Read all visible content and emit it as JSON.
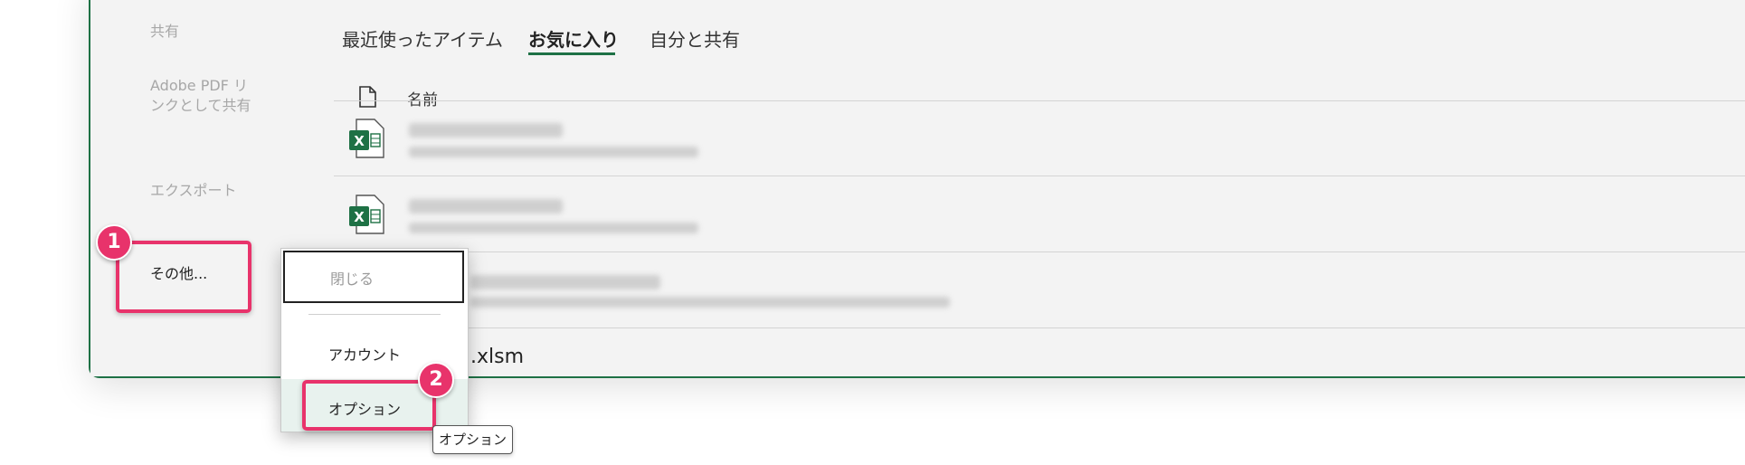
{
  "sidebar": {
    "share": "共有",
    "adobe_pdf": "Adobe PDF リンクとして共有",
    "export": "エクスポート",
    "more": "その他..."
  },
  "tabs": {
    "recent": "最近使ったアイテム",
    "favorites": "お気に入り",
    "shared": "自分と共有"
  },
  "file_list": {
    "column_name": "名前",
    "visible_file_suffix": ".xlsm"
  },
  "menu": {
    "close": "閉じる",
    "account": "アカウント",
    "options": "オプション"
  },
  "tooltip": "オプション",
  "badges": [
    "1",
    "2"
  ],
  "colors": {
    "accent": "#1e7145",
    "highlight": "#e8336b"
  }
}
